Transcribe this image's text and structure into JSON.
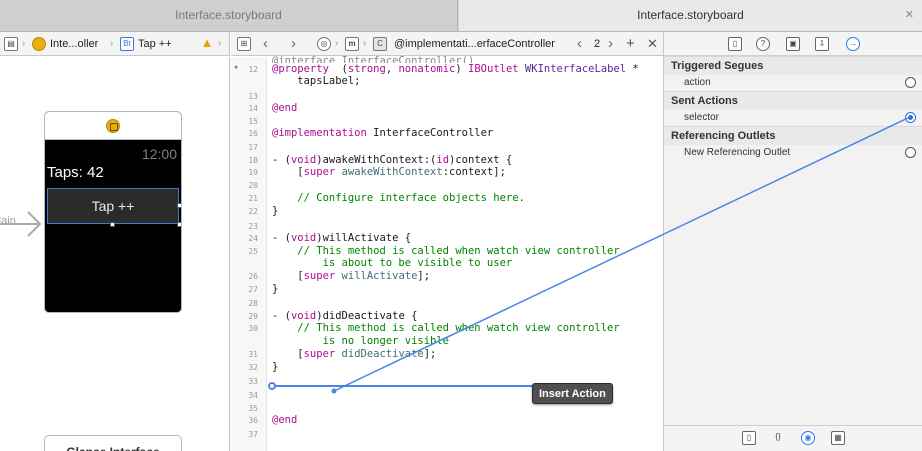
{
  "tabs": [
    {
      "label": "Interface.storyboard"
    },
    {
      "label": "Interface.storyboard"
    }
  ],
  "jumpbar_left": {
    "crumb1": "Inte...oller",
    "crumb2": "Tap ++",
    "crumb2_icon_text": "Bt"
  },
  "jumpbar_right": {
    "file_icon_text": "m",
    "symbol_icon_text": "C",
    "crumb": "@implementati...erfaceController",
    "counterpart_count": "2"
  },
  "canvas": {
    "entry_label": "Main",
    "watch_time": "12:00",
    "taps_label": "Taps: 42",
    "tap_button": "Tap ++",
    "glance_label": "Glance Interface"
  },
  "code_lines": [
    {
      "ln": "12",
      "spans": [
        [
          "kw",
          "@property"
        ],
        [
          "",
          "  ("
        ],
        [
          "kw",
          "strong"
        ],
        [
          "",
          ", "
        ],
        [
          "kw",
          "nonatomic"
        ],
        [
          "",
          ") "
        ],
        [
          "kw",
          "IBOutlet"
        ],
        [
          "",
          ""
        ],
        [
          "ty",
          " WKInterfaceLabel"
        ],
        [
          "",
          " *"
        ]
      ]
    },
    {
      "ln": "",
      "spans": [
        [
          "",
          "    tapsLabel;"
        ]
      ]
    },
    {
      "ln": "13",
      "spans": [
        [
          "",
          ""
        ]
      ]
    },
    {
      "ln": "14",
      "spans": [
        [
          "kw",
          "@end"
        ]
      ]
    },
    {
      "ln": "15",
      "spans": [
        [
          "",
          ""
        ]
      ]
    },
    {
      "ln": "16",
      "spans": [
        [
          "kw",
          "@implementation"
        ],
        [
          "",
          " InterfaceController"
        ]
      ]
    },
    {
      "ln": "17",
      "spans": [
        [
          "",
          ""
        ]
      ]
    },
    {
      "ln": "18",
      "spans": [
        [
          "",
          "- ("
        ],
        [
          "kw",
          "void"
        ],
        [
          "",
          ")awakeWithContext:("
        ],
        [
          "kw",
          "id"
        ],
        [
          "",
          ")context {"
        ]
      ]
    },
    {
      "ln": "19",
      "spans": [
        [
          "",
          "    ["
        ],
        [
          "kw",
          "super"
        ],
        [
          "",
          " "
        ],
        [
          "id",
          "awakeWithContext"
        ],
        [
          "",
          ":context];"
        ]
      ]
    },
    {
      "ln": "20",
      "spans": [
        [
          "",
          ""
        ]
      ]
    },
    {
      "ln": "21",
      "spans": [
        [
          "cm",
          "    // Configure interface objects here."
        ]
      ]
    },
    {
      "ln": "22",
      "spans": [
        [
          "",
          "}"
        ]
      ]
    },
    {
      "ln": "23",
      "spans": [
        [
          "",
          ""
        ]
      ]
    },
    {
      "ln": "24",
      "spans": [
        [
          "",
          "- ("
        ],
        [
          "kw",
          "void"
        ],
        [
          "",
          ")willActivate {"
        ]
      ]
    },
    {
      "ln": "25",
      "spans": [
        [
          "cm",
          "    // This method is called when watch view controller"
        ]
      ]
    },
    {
      "ln": "",
      "spans": [
        [
          "cm",
          "        is about to be visible to user"
        ]
      ]
    },
    {
      "ln": "26",
      "spans": [
        [
          "",
          "    ["
        ],
        [
          "kw",
          "super"
        ],
        [
          "",
          " "
        ],
        [
          "id",
          "willActivate"
        ],
        [
          "",
          "];"
        ]
      ]
    },
    {
      "ln": "27",
      "spans": [
        [
          "",
          "}"
        ]
      ]
    },
    {
      "ln": "28",
      "spans": [
        [
          "",
          ""
        ]
      ]
    },
    {
      "ln": "29",
      "spans": [
        [
          "",
          "- ("
        ],
        [
          "kw",
          "void"
        ],
        [
          "",
          ")didDeactivate {"
        ]
      ]
    },
    {
      "ln": "30",
      "spans": [
        [
          "cm",
          "    // This method is called when watch view controller"
        ]
      ]
    },
    {
      "ln": "",
      "spans": [
        [
          "cm",
          "        is no longer visible"
        ]
      ]
    },
    {
      "ln": "31",
      "spans": [
        [
          "",
          "    ["
        ],
        [
          "kw",
          "super"
        ],
        [
          "",
          " "
        ],
        [
          "id",
          "didDeactivate"
        ],
        [
          "",
          "];"
        ]
      ]
    },
    {
      "ln": "32",
      "spans": [
        [
          "",
          "}"
        ]
      ]
    },
    {
      "ln": "33",
      "spans": [
        [
          "",
          ""
        ]
      ]
    },
    {
      "ln": "34",
      "spans": [
        [
          "",
          ""
        ]
      ]
    },
    {
      "ln": "35",
      "spans": [
        [
          "",
          ""
        ]
      ]
    },
    {
      "ln": "36",
      "spans": [
        [
          "kw",
          "@end"
        ]
      ]
    },
    {
      "ln": "37",
      "spans": [
        [
          "",
          ""
        ]
      ]
    }
  ],
  "code_top_partial": "@interface InterfaceController()",
  "insert_tip": "Insert Action",
  "inspector": {
    "sections": [
      {
        "title": "Triggered Segues",
        "rows": [
          {
            "label": "action",
            "active": false
          }
        ]
      },
      {
        "title": "Sent Actions",
        "rows": [
          {
            "label": "selector",
            "active": true
          }
        ]
      },
      {
        "title": "Referencing Outlets",
        "rows": [
          {
            "label": "New Referencing Outlet",
            "active": false
          }
        ]
      }
    ],
    "toolbar_icons": [
      "file-inspector-icon",
      "help-inspector-icon",
      "identity-inspector-icon",
      "attributes-inspector-icon",
      "size-inspector-icon",
      "connections-inspector-icon"
    ],
    "library_icons": [
      "file-template-icon",
      "code-snippet-icon",
      "object-library-icon",
      "media-library-icon"
    ]
  },
  "colors": {
    "accent": "#4a86e8",
    "keyword": "#aa0d91",
    "comment": "#008400"
  }
}
